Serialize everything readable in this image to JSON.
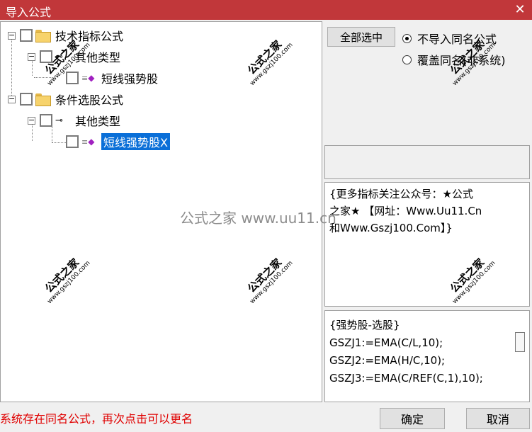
{
  "window": {
    "title": "导入公式",
    "close_glyph": "✕"
  },
  "tree": {
    "nodes": [
      {
        "label": "技术指标公式"
      },
      {
        "label": "其他类型"
      },
      {
        "label": "短线强势股"
      },
      {
        "label": "条件选股公式"
      },
      {
        "label": "其他类型"
      },
      {
        "label": "短线强势股X"
      }
    ],
    "expander_glyph": "−"
  },
  "options": {
    "select_all_label": "全部选中",
    "radio_skip_label": "不导入同名公式",
    "radio_overwrite_label": "覆盖同名(非系统)",
    "selected": "skip"
  },
  "description": {
    "line1": "{更多指标关注公众号：★公式",
    "line2": "之家★ 【网址：Www.Uu11.Cn",
    "line3": "和Www.Gszj100.Com】}"
  },
  "code": {
    "lines": [
      "{强势股-选股}",
      "GSZJ1:=EMA(C/L,10);",
      "GSZJ2:=EMA(H/C,10);",
      "GSZJ3:=EMA(C/REF(C,1),10);"
    ]
  },
  "status": {
    "message": "系统存在同名公式，再次点击可以更名"
  },
  "footer": {
    "ok_label": "确定",
    "cancel_label": "取消"
  },
  "watermarks": {
    "brand": "公式之家",
    "url": "www.gszj100.com",
    "center": "公式之家 www.uu11.cn"
  },
  "colors": {
    "titlebar": "#c1373a",
    "selection": "#0a6fd8",
    "status_text": "#e00000"
  }
}
